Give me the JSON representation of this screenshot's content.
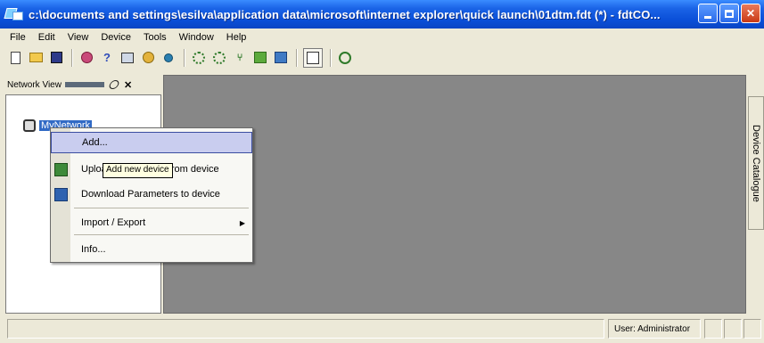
{
  "window": {
    "title": "c:\\documents and settings\\esilva\\application data\\microsoft\\internet explorer\\quick launch\\01dtm.fdt (*) - fdtCO...",
    "controls": [
      "minimize",
      "maximize",
      "close"
    ]
  },
  "menubar": {
    "items": [
      "File",
      "Edit",
      "View",
      "Device",
      "Tools",
      "Window",
      "Help"
    ]
  },
  "toolbar": {
    "buttons": [
      "new-icon",
      "open-icon",
      "save-icon",
      "color-icon",
      "help-icon",
      "device-icon",
      "connect-icon",
      "disconnect-icon",
      "network-add-icon",
      "network-remove-icon",
      "scan-icon",
      "upload-icon",
      "download-icon",
      "catalogue-icon",
      "settings-icon"
    ]
  },
  "network_view": {
    "title": "Network View",
    "root_node": "MyNetwork"
  },
  "side_panel": {
    "label": "Device Catalogue"
  },
  "context_menu": {
    "items": [
      {
        "label": "Add..."
      },
      {
        "label": "Upload Parameters from device"
      },
      {
        "label": "Download Parameters to device"
      },
      {
        "label": "Import / Export"
      },
      {
        "label": "Info..."
      }
    ]
  },
  "tooltip": {
    "text": "Add new device"
  },
  "statusbar": {
    "user": "User: Administrator"
  }
}
